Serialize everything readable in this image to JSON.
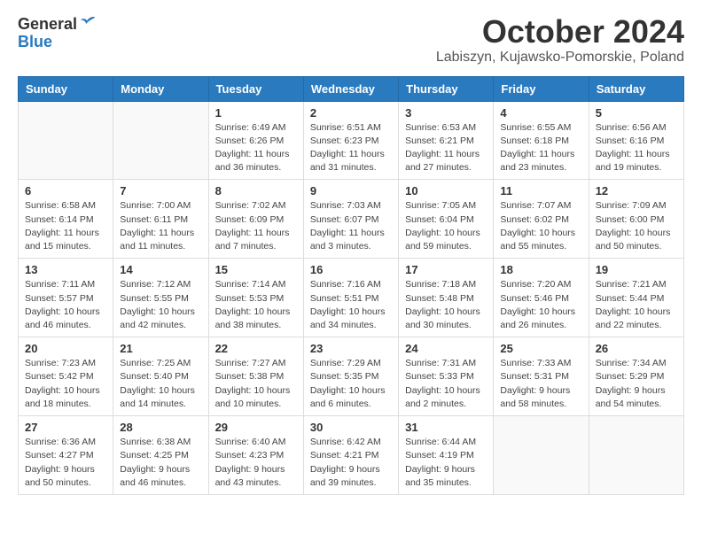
{
  "header": {
    "logo_general": "General",
    "logo_blue": "Blue",
    "title": "October 2024",
    "location": "Labiszyn, Kujawsko-Pomorskie, Poland"
  },
  "weekdays": [
    "Sunday",
    "Monday",
    "Tuesday",
    "Wednesday",
    "Thursday",
    "Friday",
    "Saturday"
  ],
  "weeks": [
    [
      {
        "day": "",
        "info": ""
      },
      {
        "day": "",
        "info": ""
      },
      {
        "day": "1",
        "info": "Sunrise: 6:49 AM\nSunset: 6:26 PM\nDaylight: 11 hours\nand 36 minutes."
      },
      {
        "day": "2",
        "info": "Sunrise: 6:51 AM\nSunset: 6:23 PM\nDaylight: 11 hours\nand 31 minutes."
      },
      {
        "day": "3",
        "info": "Sunrise: 6:53 AM\nSunset: 6:21 PM\nDaylight: 11 hours\nand 27 minutes."
      },
      {
        "day": "4",
        "info": "Sunrise: 6:55 AM\nSunset: 6:18 PM\nDaylight: 11 hours\nand 23 minutes."
      },
      {
        "day": "5",
        "info": "Sunrise: 6:56 AM\nSunset: 6:16 PM\nDaylight: 11 hours\nand 19 minutes."
      }
    ],
    [
      {
        "day": "6",
        "info": "Sunrise: 6:58 AM\nSunset: 6:14 PM\nDaylight: 11 hours\nand 15 minutes."
      },
      {
        "day": "7",
        "info": "Sunrise: 7:00 AM\nSunset: 6:11 PM\nDaylight: 11 hours\nand 11 minutes."
      },
      {
        "day": "8",
        "info": "Sunrise: 7:02 AM\nSunset: 6:09 PM\nDaylight: 11 hours\nand 7 minutes."
      },
      {
        "day": "9",
        "info": "Sunrise: 7:03 AM\nSunset: 6:07 PM\nDaylight: 11 hours\nand 3 minutes."
      },
      {
        "day": "10",
        "info": "Sunrise: 7:05 AM\nSunset: 6:04 PM\nDaylight: 10 hours\nand 59 minutes."
      },
      {
        "day": "11",
        "info": "Sunrise: 7:07 AM\nSunset: 6:02 PM\nDaylight: 10 hours\nand 55 minutes."
      },
      {
        "day": "12",
        "info": "Sunrise: 7:09 AM\nSunset: 6:00 PM\nDaylight: 10 hours\nand 50 minutes."
      }
    ],
    [
      {
        "day": "13",
        "info": "Sunrise: 7:11 AM\nSunset: 5:57 PM\nDaylight: 10 hours\nand 46 minutes."
      },
      {
        "day": "14",
        "info": "Sunrise: 7:12 AM\nSunset: 5:55 PM\nDaylight: 10 hours\nand 42 minutes."
      },
      {
        "day": "15",
        "info": "Sunrise: 7:14 AM\nSunset: 5:53 PM\nDaylight: 10 hours\nand 38 minutes."
      },
      {
        "day": "16",
        "info": "Sunrise: 7:16 AM\nSunset: 5:51 PM\nDaylight: 10 hours\nand 34 minutes."
      },
      {
        "day": "17",
        "info": "Sunrise: 7:18 AM\nSunset: 5:48 PM\nDaylight: 10 hours\nand 30 minutes."
      },
      {
        "day": "18",
        "info": "Sunrise: 7:20 AM\nSunset: 5:46 PM\nDaylight: 10 hours\nand 26 minutes."
      },
      {
        "day": "19",
        "info": "Sunrise: 7:21 AM\nSunset: 5:44 PM\nDaylight: 10 hours\nand 22 minutes."
      }
    ],
    [
      {
        "day": "20",
        "info": "Sunrise: 7:23 AM\nSunset: 5:42 PM\nDaylight: 10 hours\nand 18 minutes."
      },
      {
        "day": "21",
        "info": "Sunrise: 7:25 AM\nSunset: 5:40 PM\nDaylight: 10 hours\nand 14 minutes."
      },
      {
        "day": "22",
        "info": "Sunrise: 7:27 AM\nSunset: 5:38 PM\nDaylight: 10 hours\nand 10 minutes."
      },
      {
        "day": "23",
        "info": "Sunrise: 7:29 AM\nSunset: 5:35 PM\nDaylight: 10 hours\nand 6 minutes."
      },
      {
        "day": "24",
        "info": "Sunrise: 7:31 AM\nSunset: 5:33 PM\nDaylight: 10 hours\nand 2 minutes."
      },
      {
        "day": "25",
        "info": "Sunrise: 7:33 AM\nSunset: 5:31 PM\nDaylight: 9 hours\nand 58 minutes."
      },
      {
        "day": "26",
        "info": "Sunrise: 7:34 AM\nSunset: 5:29 PM\nDaylight: 9 hours\nand 54 minutes."
      }
    ],
    [
      {
        "day": "27",
        "info": "Sunrise: 6:36 AM\nSunset: 4:27 PM\nDaylight: 9 hours\nand 50 minutes."
      },
      {
        "day": "28",
        "info": "Sunrise: 6:38 AM\nSunset: 4:25 PM\nDaylight: 9 hours\nand 46 minutes."
      },
      {
        "day": "29",
        "info": "Sunrise: 6:40 AM\nSunset: 4:23 PM\nDaylight: 9 hours\nand 43 minutes."
      },
      {
        "day": "30",
        "info": "Sunrise: 6:42 AM\nSunset: 4:21 PM\nDaylight: 9 hours\nand 39 minutes."
      },
      {
        "day": "31",
        "info": "Sunrise: 6:44 AM\nSunset: 4:19 PM\nDaylight: 9 hours\nand 35 minutes."
      },
      {
        "day": "",
        "info": ""
      },
      {
        "day": "",
        "info": ""
      }
    ]
  ]
}
